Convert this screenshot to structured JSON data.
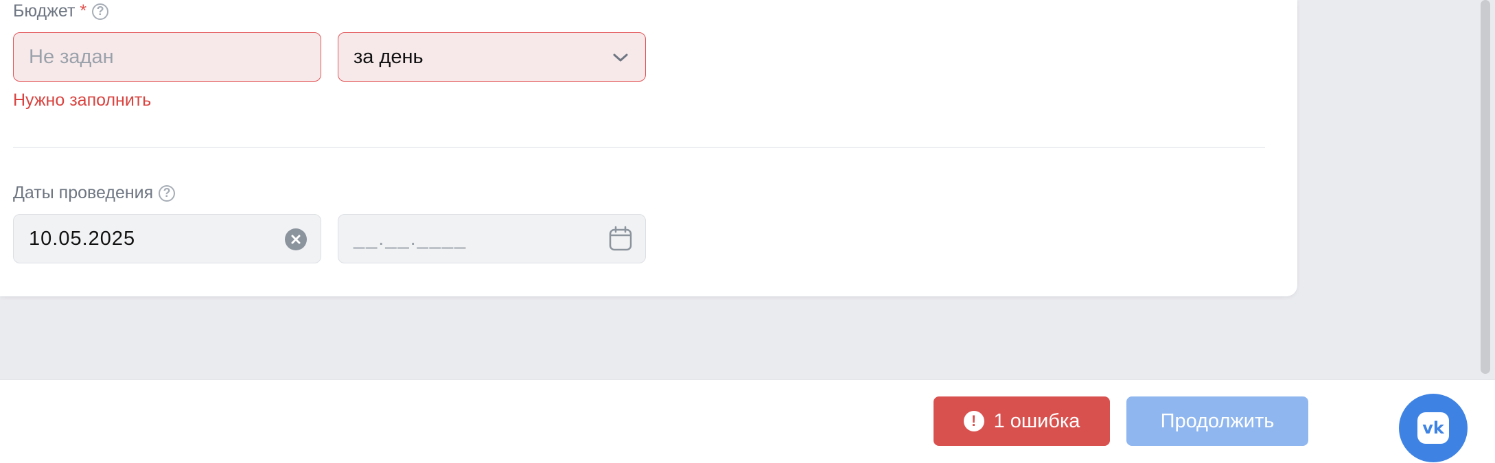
{
  "budget": {
    "label": "Бюджет",
    "required_mark": "*",
    "amount_placeholder": "Не задан",
    "period_value": "за день",
    "error_message": "Нужно заполнить"
  },
  "dates": {
    "label": "Даты проведения",
    "start_value": "10.05.2025",
    "end_placeholder": "__.__.____"
  },
  "footer": {
    "error_count_label": "1 ошибка",
    "continue_label": "Продолжить"
  },
  "icons": {
    "help": "question-circle-icon",
    "dropdown": "chevron-down-icon",
    "clear": "clear-circle-icon",
    "calendar": "calendar-icon",
    "error": "exclamation-circle-icon",
    "vk": "vk-logo-icon"
  },
  "colors": {
    "error": "#d9514e",
    "primary": "#8fb6ef",
    "vk_blue": "#3e83e4"
  }
}
